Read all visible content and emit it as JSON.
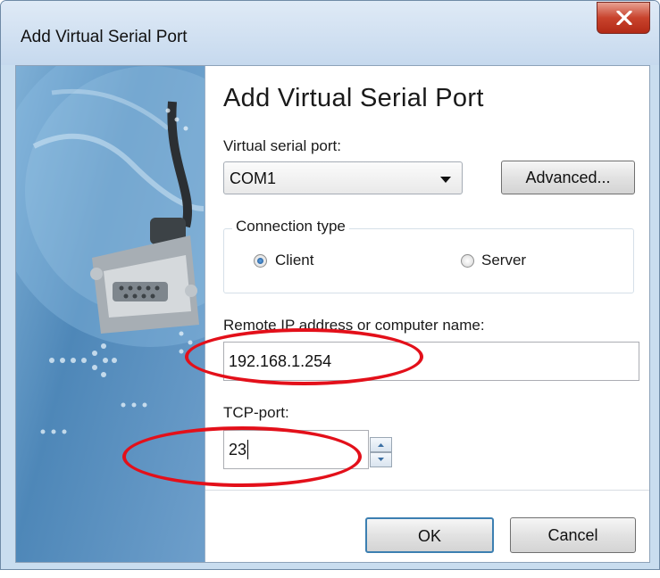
{
  "window": {
    "title": "Add Virtual Serial Port"
  },
  "dialog": {
    "heading": "Add Virtual Serial Port",
    "port_label": "Virtual serial port:",
    "port_value": "COM1",
    "advanced_label": "Advanced...",
    "connection_group_title": "Connection type",
    "client_label": "Client",
    "server_label": "Server",
    "selected_connection": "Client",
    "remote_label": "Remote IP address or computer name:",
    "remote_value": "192.168.1.254",
    "tcp_label": "TCP-port:",
    "tcp_value": "23",
    "ok_label": "OK",
    "cancel_label": "Cancel"
  },
  "annotation_color": "#e3101a"
}
